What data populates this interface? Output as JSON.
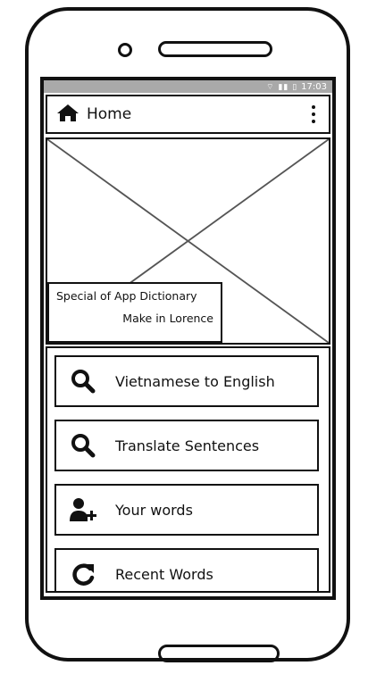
{
  "status_bar": {
    "icons": "wifi-signal-battery",
    "time": "17:03"
  },
  "app_bar": {
    "title": "Home",
    "home_icon": "home-icon",
    "menu_icon": "more-vert-icon"
  },
  "hero": {
    "caption_line1": "Special of App Dictionary",
    "caption_line2": "Make in Lorence"
  },
  "menu": [
    {
      "label": "Vietnamese to English",
      "icon": "search-icon"
    },
    {
      "label": "Translate Sentences",
      "icon": "search-icon"
    },
    {
      "label": "Your words",
      "icon": "add-user-icon"
    },
    {
      "label": "Recent Words",
      "icon": "refresh-icon"
    }
  ]
}
